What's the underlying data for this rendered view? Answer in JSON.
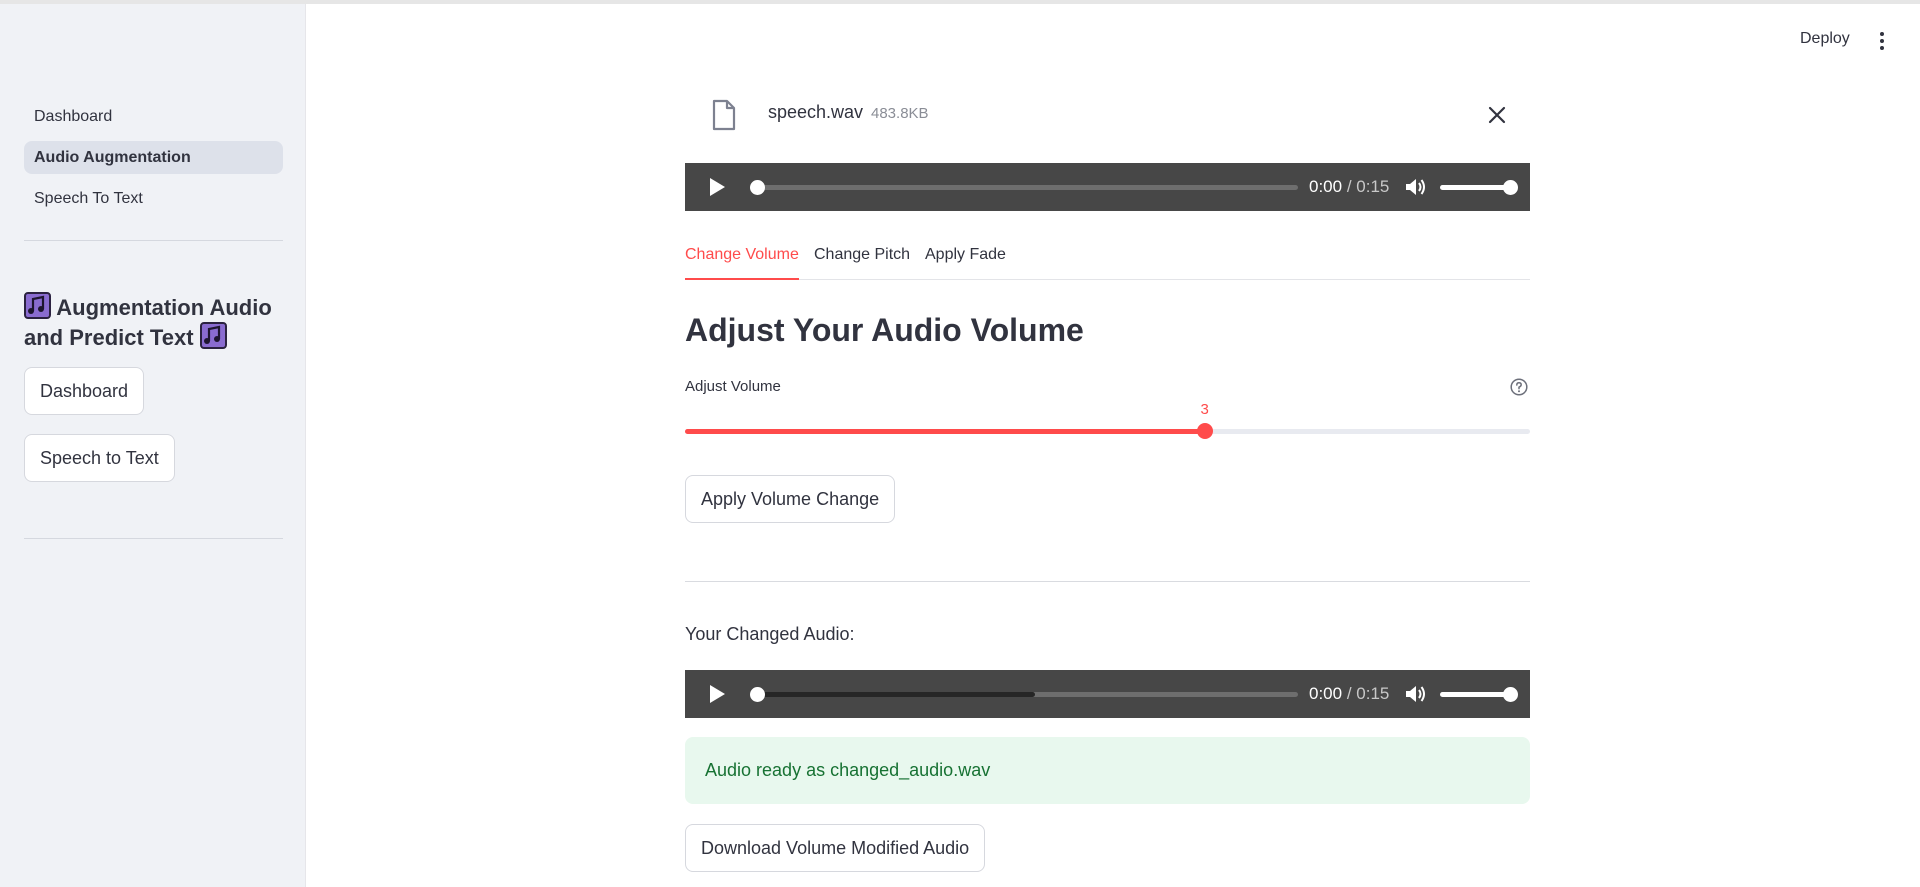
{
  "sidebar": {
    "nav": [
      {
        "label": "Dashboard",
        "active": false
      },
      {
        "label": "Audio Augmentation",
        "active": true
      },
      {
        "label": "Speech To Text",
        "active": false
      }
    ],
    "title_line1": "Augmentation Audio",
    "title_line2": "and Predict Text",
    "buttons": {
      "dashboard": "Dashboard",
      "speech_to_text": "Speech to Text"
    }
  },
  "header": {
    "deploy_label": "Deploy"
  },
  "file": {
    "name": "speech.wav",
    "size": "483.8KB"
  },
  "players": {
    "original": {
      "current": "0:00",
      "duration": "/ 0:15",
      "progress": 0,
      "buffered": 0
    },
    "changed": {
      "current": "0:00",
      "duration": "/ 0:15",
      "progress": 0,
      "buffered": 0.52
    }
  },
  "tabs": [
    {
      "label": "Change Volume",
      "active": true
    },
    {
      "label": "Change Pitch",
      "active": false
    },
    {
      "label": "Apply Fade",
      "active": false
    }
  ],
  "main": {
    "heading": "Adjust Your Audio Volume",
    "slider": {
      "label": "Adjust Volume",
      "value": "3",
      "fraction": 0.615
    },
    "apply_button": "Apply Volume Change",
    "changed_label": "Your Changed Audio:",
    "success_message": "Audio ready as changed_audio.wav",
    "download_button": "Download Volume Modified Audio"
  },
  "colors": {
    "accent": "#ff4b4b",
    "sidebar_bg": "#f0f2f6",
    "player_bg": "#474747",
    "success_bg": "#e8f8ee",
    "success_text": "#177233"
  }
}
